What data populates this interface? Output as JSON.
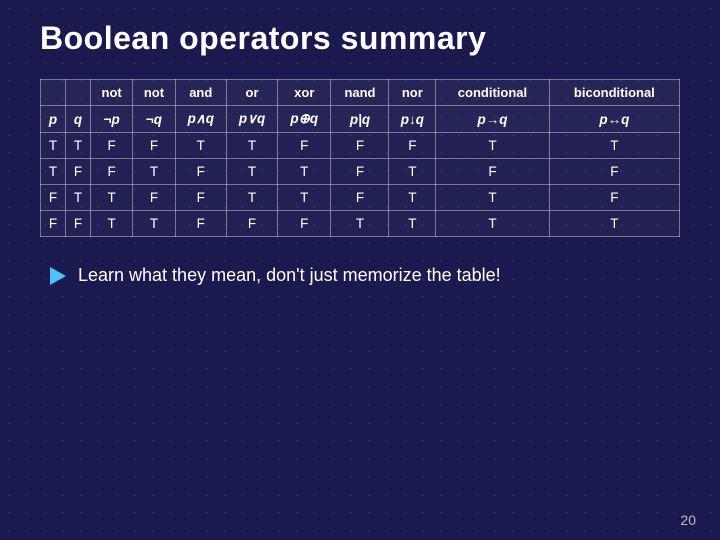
{
  "title": "Boolean operators summary",
  "table": {
    "header": [
      "",
      "",
      "not",
      "not",
      "and",
      "or",
      "xor",
      "nand",
      "nor",
      "conditional",
      "biconditional"
    ],
    "subheader": [
      "p",
      "q",
      "¬p",
      "¬q",
      "p∧q",
      "p∨q",
      "p⊕q",
      "p|q",
      "p↓q",
      "p→q",
      "p↔q"
    ],
    "rows": [
      [
        "T",
        "T",
        "F",
        "F",
        "T",
        "T",
        "F",
        "F",
        "F",
        "T",
        "T"
      ],
      [
        "T",
        "F",
        "F",
        "T",
        "F",
        "T",
        "T",
        "F",
        "T",
        "F",
        "F"
      ],
      [
        "F",
        "T",
        "T",
        "F",
        "F",
        "T",
        "T",
        "F",
        "T",
        "T",
        "F"
      ],
      [
        "F",
        "F",
        "T",
        "T",
        "F",
        "F",
        "F",
        "T",
        "T",
        "T",
        "T"
      ]
    ]
  },
  "bottom_text": "Learn   what   they   mean,   don't   just memorize the table!",
  "page_number": "20"
}
